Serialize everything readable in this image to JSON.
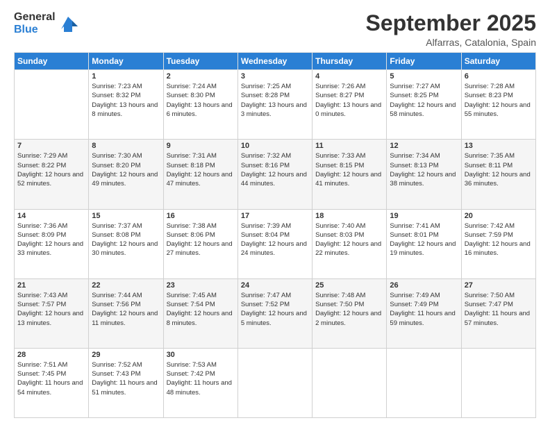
{
  "logo": {
    "general": "General",
    "blue": "Blue"
  },
  "title": "September 2025",
  "location": "Alfarras, Catalonia, Spain",
  "headers": [
    "Sunday",
    "Monday",
    "Tuesday",
    "Wednesday",
    "Thursday",
    "Friday",
    "Saturday"
  ],
  "weeks": [
    [
      {
        "day": "",
        "sunrise": "",
        "sunset": "",
        "daylight": ""
      },
      {
        "day": "1",
        "sunrise": "Sunrise: 7:23 AM",
        "sunset": "Sunset: 8:32 PM",
        "daylight": "Daylight: 13 hours and 8 minutes."
      },
      {
        "day": "2",
        "sunrise": "Sunrise: 7:24 AM",
        "sunset": "Sunset: 8:30 PM",
        "daylight": "Daylight: 13 hours and 6 minutes."
      },
      {
        "day": "3",
        "sunrise": "Sunrise: 7:25 AM",
        "sunset": "Sunset: 8:28 PM",
        "daylight": "Daylight: 13 hours and 3 minutes."
      },
      {
        "day": "4",
        "sunrise": "Sunrise: 7:26 AM",
        "sunset": "Sunset: 8:27 PM",
        "daylight": "Daylight: 13 hours and 0 minutes."
      },
      {
        "day": "5",
        "sunrise": "Sunrise: 7:27 AM",
        "sunset": "Sunset: 8:25 PM",
        "daylight": "Daylight: 12 hours and 58 minutes."
      },
      {
        "day": "6",
        "sunrise": "Sunrise: 7:28 AM",
        "sunset": "Sunset: 8:23 PM",
        "daylight": "Daylight: 12 hours and 55 minutes."
      }
    ],
    [
      {
        "day": "7",
        "sunrise": "Sunrise: 7:29 AM",
        "sunset": "Sunset: 8:22 PM",
        "daylight": "Daylight: 12 hours and 52 minutes."
      },
      {
        "day": "8",
        "sunrise": "Sunrise: 7:30 AM",
        "sunset": "Sunset: 8:20 PM",
        "daylight": "Daylight: 12 hours and 49 minutes."
      },
      {
        "day": "9",
        "sunrise": "Sunrise: 7:31 AM",
        "sunset": "Sunset: 8:18 PM",
        "daylight": "Daylight: 12 hours and 47 minutes."
      },
      {
        "day": "10",
        "sunrise": "Sunrise: 7:32 AM",
        "sunset": "Sunset: 8:16 PM",
        "daylight": "Daylight: 12 hours and 44 minutes."
      },
      {
        "day": "11",
        "sunrise": "Sunrise: 7:33 AM",
        "sunset": "Sunset: 8:15 PM",
        "daylight": "Daylight: 12 hours and 41 minutes."
      },
      {
        "day": "12",
        "sunrise": "Sunrise: 7:34 AM",
        "sunset": "Sunset: 8:13 PM",
        "daylight": "Daylight: 12 hours and 38 minutes."
      },
      {
        "day": "13",
        "sunrise": "Sunrise: 7:35 AM",
        "sunset": "Sunset: 8:11 PM",
        "daylight": "Daylight: 12 hours and 36 minutes."
      }
    ],
    [
      {
        "day": "14",
        "sunrise": "Sunrise: 7:36 AM",
        "sunset": "Sunset: 8:09 PM",
        "daylight": "Daylight: 12 hours and 33 minutes."
      },
      {
        "day": "15",
        "sunrise": "Sunrise: 7:37 AM",
        "sunset": "Sunset: 8:08 PM",
        "daylight": "Daylight: 12 hours and 30 minutes."
      },
      {
        "day": "16",
        "sunrise": "Sunrise: 7:38 AM",
        "sunset": "Sunset: 8:06 PM",
        "daylight": "Daylight: 12 hours and 27 minutes."
      },
      {
        "day": "17",
        "sunrise": "Sunrise: 7:39 AM",
        "sunset": "Sunset: 8:04 PM",
        "daylight": "Daylight: 12 hours and 24 minutes."
      },
      {
        "day": "18",
        "sunrise": "Sunrise: 7:40 AM",
        "sunset": "Sunset: 8:03 PM",
        "daylight": "Daylight: 12 hours and 22 minutes."
      },
      {
        "day": "19",
        "sunrise": "Sunrise: 7:41 AM",
        "sunset": "Sunset: 8:01 PM",
        "daylight": "Daylight: 12 hours and 19 minutes."
      },
      {
        "day": "20",
        "sunrise": "Sunrise: 7:42 AM",
        "sunset": "Sunset: 7:59 PM",
        "daylight": "Daylight: 12 hours and 16 minutes."
      }
    ],
    [
      {
        "day": "21",
        "sunrise": "Sunrise: 7:43 AM",
        "sunset": "Sunset: 7:57 PM",
        "daylight": "Daylight: 12 hours and 13 minutes."
      },
      {
        "day": "22",
        "sunrise": "Sunrise: 7:44 AM",
        "sunset": "Sunset: 7:56 PM",
        "daylight": "Daylight: 12 hours and 11 minutes."
      },
      {
        "day": "23",
        "sunrise": "Sunrise: 7:45 AM",
        "sunset": "Sunset: 7:54 PM",
        "daylight": "Daylight: 12 hours and 8 minutes."
      },
      {
        "day": "24",
        "sunrise": "Sunrise: 7:47 AM",
        "sunset": "Sunset: 7:52 PM",
        "daylight": "Daylight: 12 hours and 5 minutes."
      },
      {
        "day": "25",
        "sunrise": "Sunrise: 7:48 AM",
        "sunset": "Sunset: 7:50 PM",
        "daylight": "Daylight: 12 hours and 2 minutes."
      },
      {
        "day": "26",
        "sunrise": "Sunrise: 7:49 AM",
        "sunset": "Sunset: 7:49 PM",
        "daylight": "Daylight: 11 hours and 59 minutes."
      },
      {
        "day": "27",
        "sunrise": "Sunrise: 7:50 AM",
        "sunset": "Sunset: 7:47 PM",
        "daylight": "Daylight: 11 hours and 57 minutes."
      }
    ],
    [
      {
        "day": "28",
        "sunrise": "Sunrise: 7:51 AM",
        "sunset": "Sunset: 7:45 PM",
        "daylight": "Daylight: 11 hours and 54 minutes."
      },
      {
        "day": "29",
        "sunrise": "Sunrise: 7:52 AM",
        "sunset": "Sunset: 7:43 PM",
        "daylight": "Daylight: 11 hours and 51 minutes."
      },
      {
        "day": "30",
        "sunrise": "Sunrise: 7:53 AM",
        "sunset": "Sunset: 7:42 PM",
        "daylight": "Daylight: 11 hours and 48 minutes."
      },
      {
        "day": "",
        "sunrise": "",
        "sunset": "",
        "daylight": ""
      },
      {
        "day": "",
        "sunrise": "",
        "sunset": "",
        "daylight": ""
      },
      {
        "day": "",
        "sunrise": "",
        "sunset": "",
        "daylight": ""
      },
      {
        "day": "",
        "sunrise": "",
        "sunset": "",
        "daylight": ""
      }
    ]
  ]
}
